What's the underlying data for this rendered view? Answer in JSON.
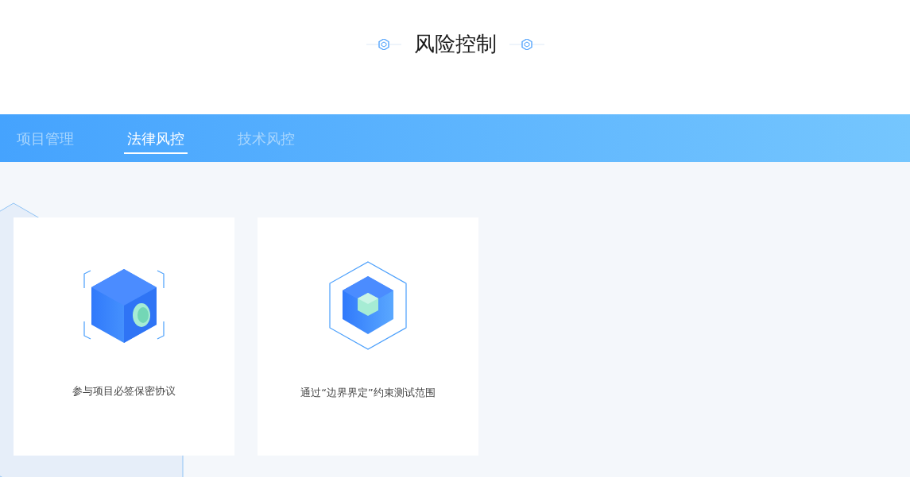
{
  "title": "风险控制",
  "tabs": [
    {
      "label": "项目管理",
      "selected": false
    },
    {
      "label": "法律风控",
      "selected": true
    },
    {
      "label": "技术风控",
      "selected": false
    }
  ],
  "cards": [
    {
      "kind": "safe",
      "text": "参与项目必签保密协议"
    },
    {
      "kind": "cube",
      "text": "通过“边界界定”约束测试范围"
    }
  ]
}
